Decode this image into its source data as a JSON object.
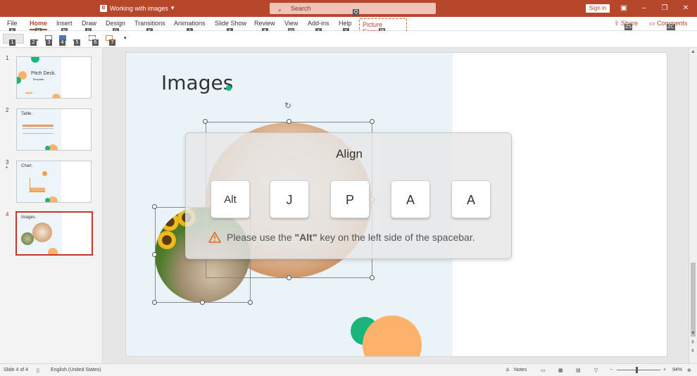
{
  "app": {
    "file_title": "Working with images",
    "search_placeholder": "Search",
    "sign_in": "Sign in"
  },
  "ribbon": {
    "tabs": [
      "File",
      "Home",
      "Insert",
      "Draw",
      "Design",
      "Transitions",
      "Animations",
      "Slide Show",
      "Review",
      "View",
      "Add-ins",
      "Help"
    ],
    "picture_format": "Picture Format",
    "share": "Share",
    "comments": "Comments",
    "tab_keytips": [
      "F",
      "H",
      "N",
      "JI",
      "G",
      "K",
      "A",
      "S",
      "R",
      "W",
      "X",
      "Y"
    ],
    "picture_format_keytip": "JP",
    "search_keytip": "Q",
    "share_keytip": "ZS",
    "comments_keytip": "ZC",
    "toolbar_keytips": [
      "1",
      "2",
      "3",
      "4",
      "5",
      "6",
      "7"
    ]
  },
  "slides_panel": {
    "slides": [
      {
        "number": "1",
        "title": "Pitch Deck.",
        "subtitle": "Template"
      },
      {
        "number": "2",
        "title": "Table."
      },
      {
        "number": "3",
        "title": "Chart.",
        "marker": "*"
      },
      {
        "number": "4",
        "title": "Images."
      }
    ]
  },
  "slide": {
    "title": "Images"
  },
  "overlay": {
    "title": "Align",
    "keys": [
      "Alt",
      "J",
      "P",
      "A",
      "A"
    ],
    "warning_prefix": "Please use the ",
    "warning_key": "\"Alt\"",
    "warning_suffix": " key on the left side of the spacebar."
  },
  "status": {
    "slide_info": "Slide 4 of 4",
    "language": "English (United States)",
    "notes": "Notes",
    "zoom": "94%"
  },
  "colors": {
    "accent": "#b7472a",
    "green": "#1ab57a",
    "orange": "#fdb26b"
  }
}
